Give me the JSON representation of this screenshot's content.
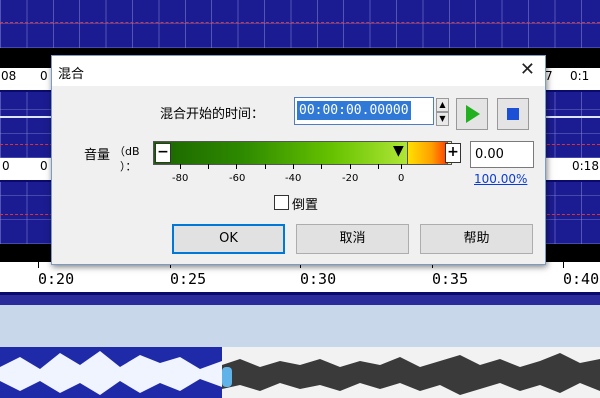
{
  "dialog": {
    "title": "混合",
    "start_time_label": "混合开始的时间：",
    "start_time_value": "00:00:00.00000",
    "volume_label": "音量",
    "volume_unit": "（dB",
    "volume_unit2": "）：",
    "minus": "−",
    "plus": "+",
    "db_value": "0.00",
    "percent_link": "100.00%",
    "invert_label": "倒置",
    "buttons": {
      "ok": "OK",
      "cancel": "取消",
      "help": "帮助"
    },
    "scale": [
      "-80",
      "-60",
      "-40",
      "-20",
      "0"
    ]
  },
  "background": {
    "ruler_top": [
      "08",
      "0",
      "7",
      "0:1"
    ],
    "ruler_mid": [
      "0",
      "0",
      "0:18"
    ],
    "timeline": [
      "0:20",
      "0:25",
      "0:30",
      "0:35",
      "0:40"
    ]
  },
  "colors": {
    "track": "#1c1c92",
    "play_green": "#22b020",
    "stop_blue": "#1a4fd6",
    "link": "#0b3bd8"
  }
}
